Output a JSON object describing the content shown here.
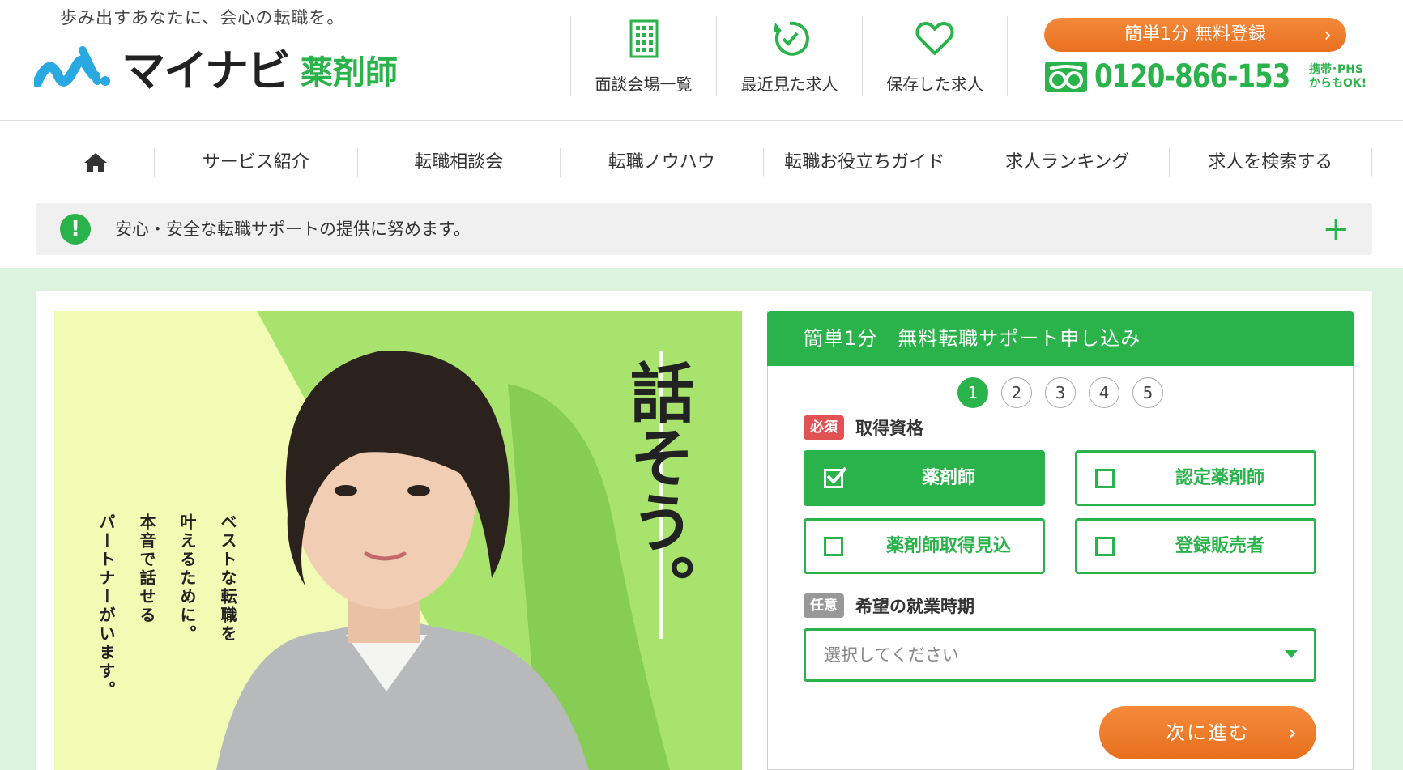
{
  "header": {
    "tagline": "歩み出すあなたに、会心の転職を。",
    "logo": {
      "name": "マイナビ",
      "sub": "薬剤師"
    },
    "nav": [
      {
        "label": "面談会場一覧",
        "icon": "building-icon"
      },
      {
        "label": "最近見た求人",
        "icon": "history-icon"
      },
      {
        "label": "保存した求人",
        "icon": "heart-icon"
      }
    ],
    "register_button": "簡単1分 無料登録",
    "phone": "0120-866-153",
    "phone_note_1": "携帯･PHS",
    "phone_note_2": "からもOK!"
  },
  "main_nav": {
    "home_icon": "home-icon",
    "items": [
      "サービス紹介",
      "転職相談会",
      "転職ノウハウ",
      "転職お役立ちガイド",
      "求人ランキング",
      "求人を検索する"
    ]
  },
  "notice": {
    "icon": "!",
    "text": "安心・安全な転職サポートの提供に努めます。",
    "expand": "+"
  },
  "hero": {
    "headline": "話そう。",
    "copy_lines": [
      "ベストな転職を",
      "叶えるために。",
      "本音で話せる",
      "パートナーがいます。"
    ]
  },
  "form": {
    "title": "簡単1分　無料転職サポート申し込み",
    "steps": [
      "1",
      "2",
      "3",
      "4",
      "5"
    ],
    "active_step": 1,
    "field1": {
      "badge": "必須",
      "label": "取得資格"
    },
    "options": [
      {
        "label": "薬剤師",
        "checked": true
      },
      {
        "label": "認定薬剤師",
        "checked": false
      },
      {
        "label": "薬剤師取得見込",
        "checked": false
      },
      {
        "label": "登録販売者",
        "checked": false
      }
    ],
    "field2": {
      "badge": "任意",
      "label": "希望の就業時期"
    },
    "select_placeholder": "選択してください",
    "next_button": "次に進む"
  },
  "colors": {
    "brand_green": "#29b34a",
    "accent_orange": "#ee7a28",
    "required_red": "#e05254",
    "page_bg": "#dcf4df"
  }
}
